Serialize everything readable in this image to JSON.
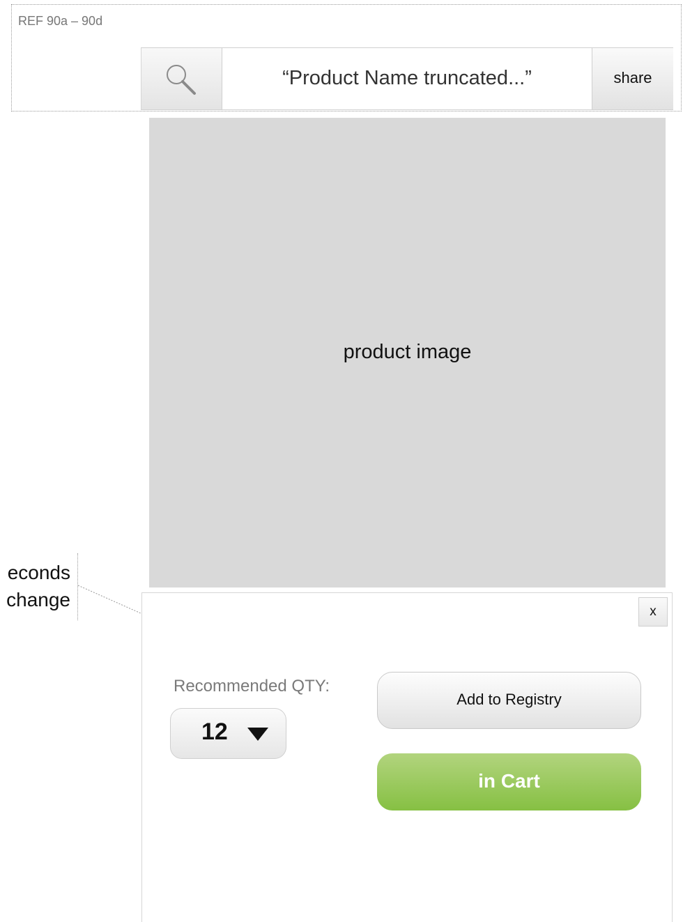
{
  "reference": {
    "label": "REF 90a – 90d"
  },
  "header": {
    "search_icon": "search-icon",
    "product_name": "“Product Name truncated...”",
    "share_label": "share"
  },
  "product": {
    "image_label": "product image"
  },
  "panel": {
    "close_label": "x",
    "qty_label": "Recommended QTY:",
    "qty_value": "12",
    "registry_label": "Add to Registry",
    "cart_label": "in Cart"
  },
  "annotation": {
    "line1": "econds",
    "line2": "change"
  },
  "colors": {
    "cart_button_top": "#b2d47e",
    "cart_button_bottom": "#86c043",
    "image_placeholder": "#d9d9d9"
  }
}
